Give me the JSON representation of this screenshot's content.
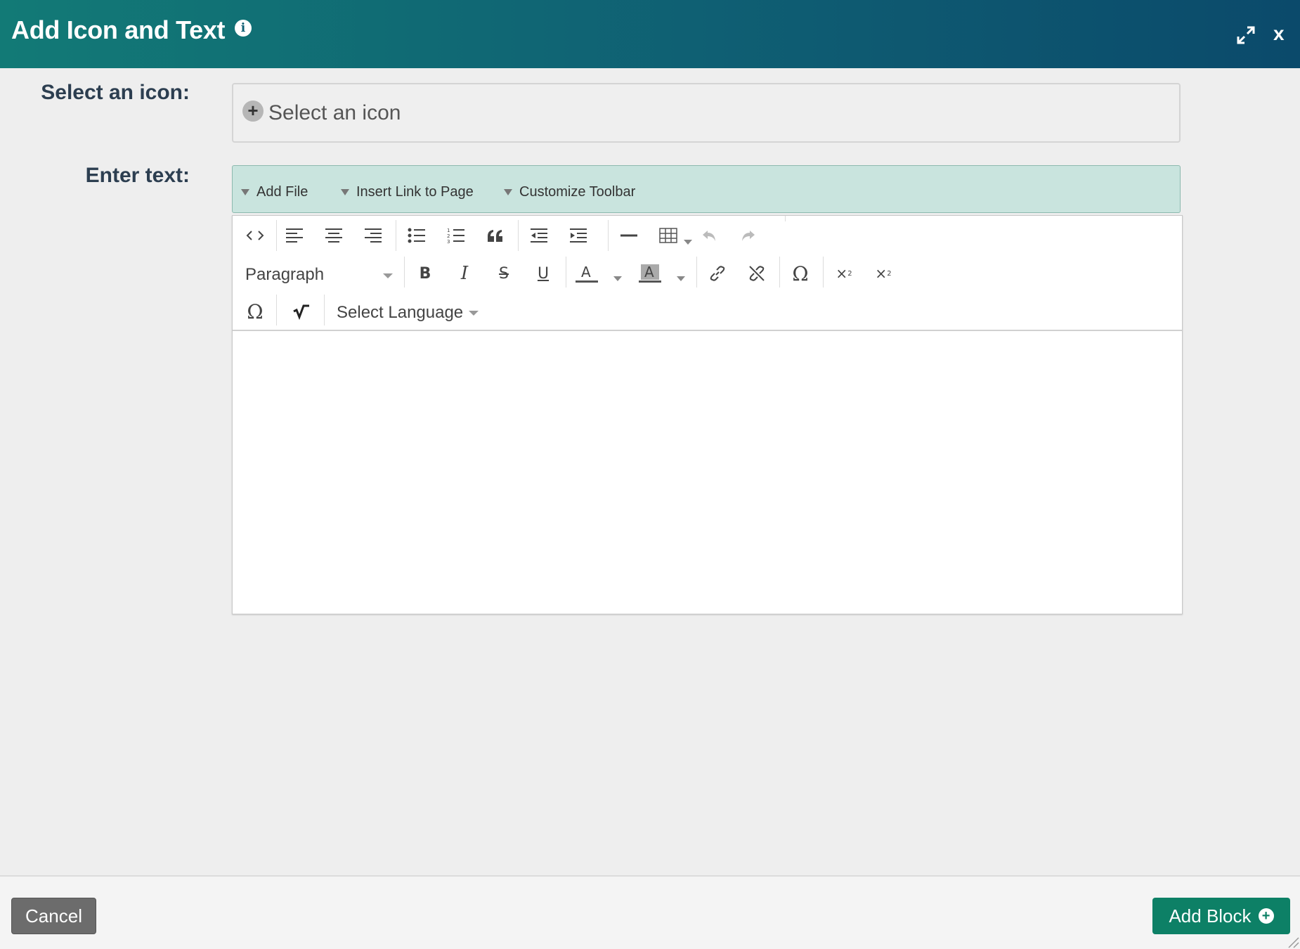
{
  "header": {
    "title": "Add Icon and Text",
    "info_icon": "info-icon",
    "expand_icon": "expand-icon",
    "close_label": "x"
  },
  "icon_field": {
    "label": "Select an icon:",
    "placeholder": "Select an icon",
    "plus_glyph": "+"
  },
  "text_field": {
    "label": "Enter text:"
  },
  "plugin_bar": {
    "items": [
      "Add File",
      "Insert Link to Page",
      "Customize Toolbar"
    ]
  },
  "editor_toolbar": {
    "row1": [
      "source-code",
      "align-left",
      "align-center",
      "align-right",
      "bulleted-list",
      "numbered-list",
      "blockquote",
      "outdent",
      "indent",
      "horizontal-rule",
      "table",
      "undo",
      "redo"
    ],
    "format_select": "Paragraph",
    "row2": [
      "bold",
      "italic",
      "strikethrough",
      "underline",
      "text-color",
      "background-color",
      "link",
      "unlink",
      "special-character",
      "superscript",
      "subscript"
    ],
    "row3": [
      "special-character",
      "math"
    ],
    "language_select": "Select Language"
  },
  "footer": {
    "cancel_label": "Cancel",
    "add_label": "Add Block"
  },
  "colors": {
    "header_start": "#127a76",
    "header_end": "#0b4a6b",
    "plugin_bar_bg": "#c9e4de",
    "add_button": "#0d8066",
    "cancel_button": "#6c6c6c"
  }
}
